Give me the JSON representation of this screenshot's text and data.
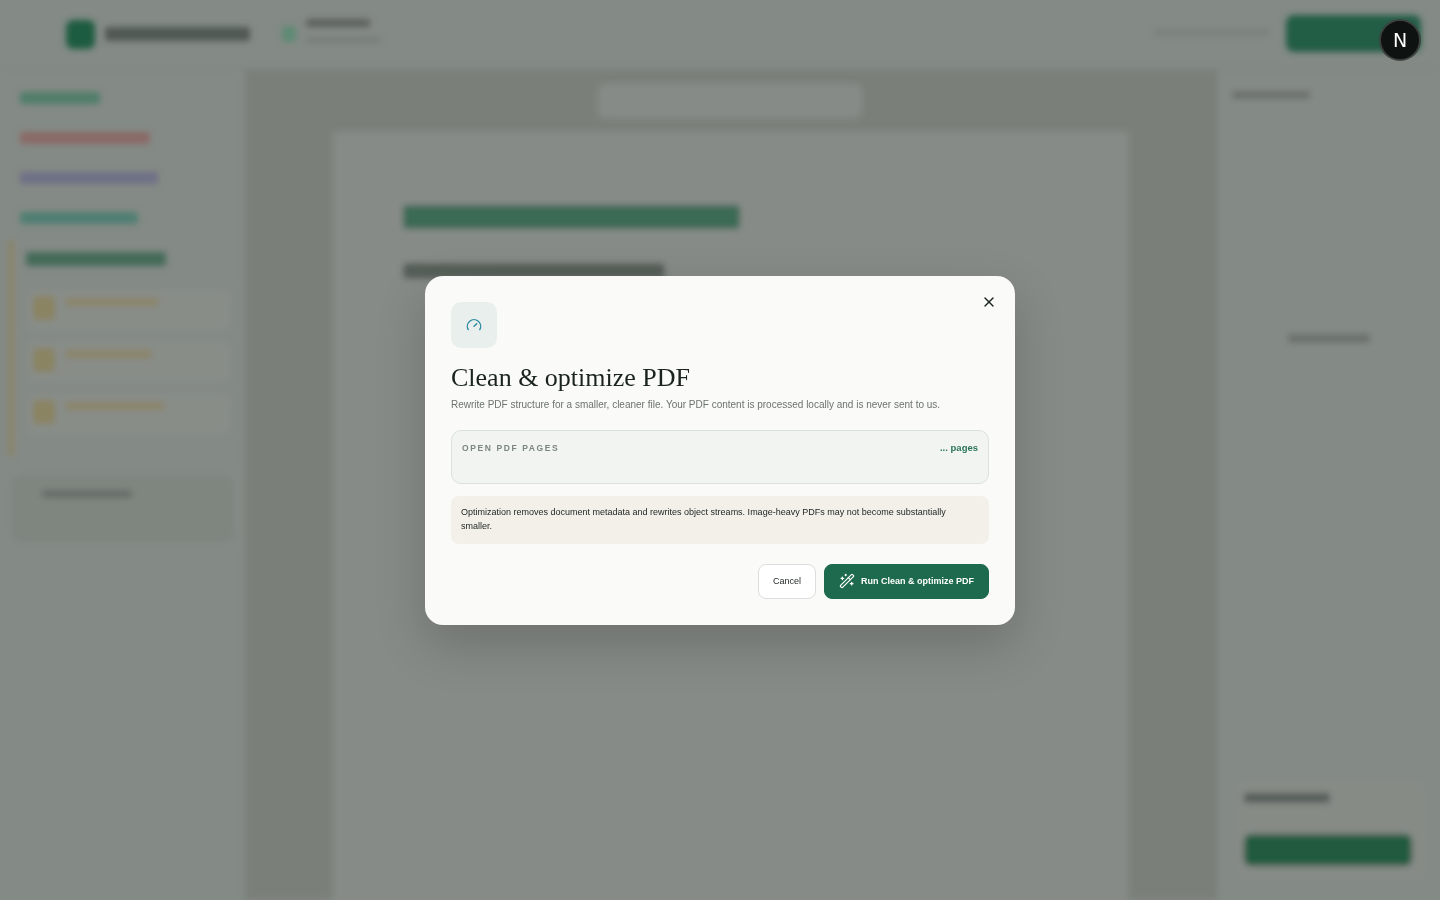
{
  "dialog": {
    "title": "Clean & optimize PDF",
    "description": "Rewrite PDF structure for a smaller, cleaner file. Your PDF content is processed locally and is never sent to us.",
    "pages_field": {
      "label": "OPEN PDF PAGES",
      "count": "... pages"
    },
    "note": "Optimization removes document metadata and rewrites object streams. Image-heavy PDFs may not become substantially smaller.",
    "buttons": [
      {
        "label": "Cancel",
        "kind": "secondary"
      },
      {
        "label": "Run Clean & optimize PDF",
        "kind": "primary"
      }
    ]
  },
  "dev_badge": {
    "label": "N"
  }
}
